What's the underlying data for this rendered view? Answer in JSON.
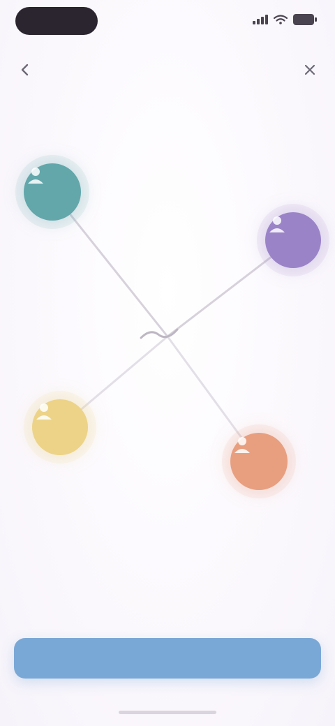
{
  "status_bar": {
    "time": "",
    "icons": [
      "signal-icon",
      "wifi-icon",
      "battery-icon"
    ]
  },
  "header": {
    "title": "",
    "back_icon": "back-arrow-icon",
    "close_icon": "close-icon"
  },
  "graph": {
    "nodes": [
      {
        "name": "teal",
        "color": "#63a7ab",
        "icon": "person-icon"
      },
      {
        "name": "purple",
        "color": "#9b83c8",
        "icon": "person-icon"
      },
      {
        "name": "yellow",
        "color": "#ecd388",
        "icon": "person-icon"
      },
      {
        "name": "orange",
        "color": "#e89f80",
        "icon": "person-icon"
      }
    ],
    "center_icon": "link-icon",
    "edge_color": "#cfcad4"
  },
  "caption": "",
  "cta": {
    "label": "",
    "color": "#7aa8d6"
  }
}
